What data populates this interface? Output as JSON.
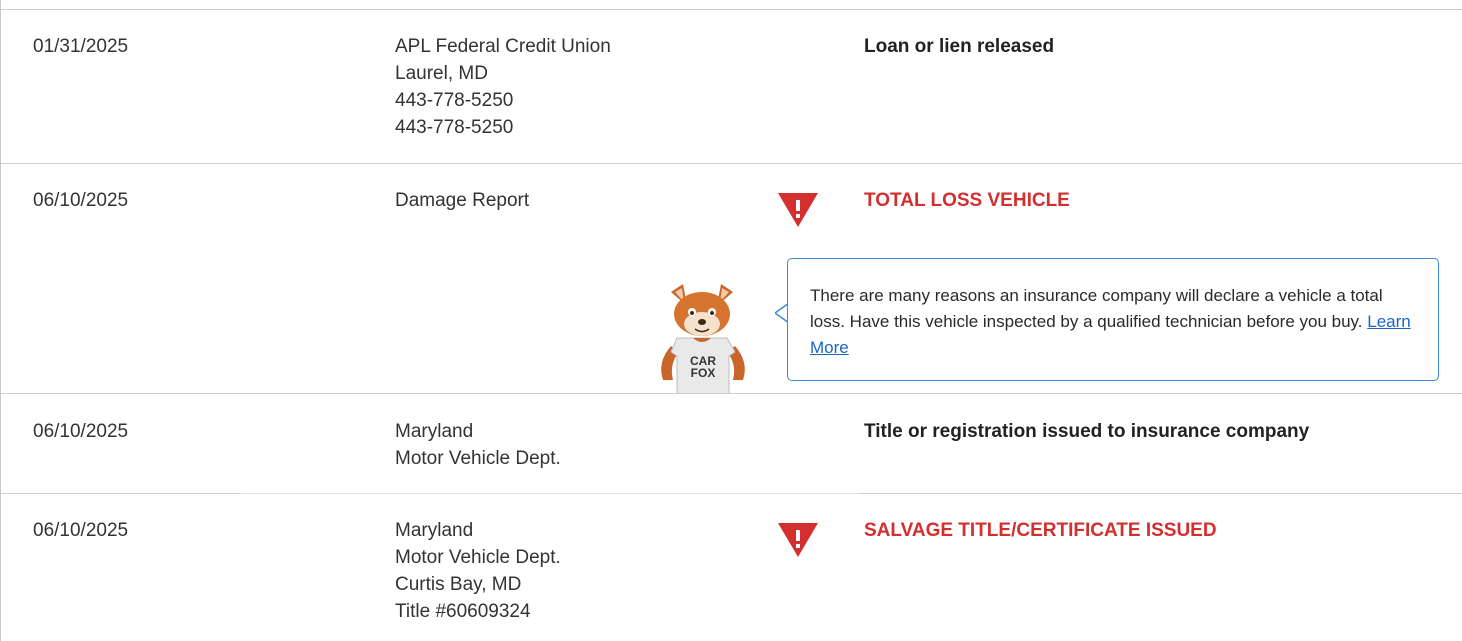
{
  "records": [
    {
      "date": "01/31/2025",
      "source_lines": [
        "APL Federal Credit Union",
        "Laurel, MD",
        "443-778-5250",
        "443-778-5250"
      ],
      "comment": "Loan or lien released",
      "alert": false
    },
    {
      "date": "06/10/2025",
      "source_lines": [
        "Damage Report"
      ],
      "comment": "TOTAL LOSS VEHICLE",
      "alert": true,
      "callout": {
        "text": "There are many reasons an insurance company will declare a vehicle a total loss. Have this vehicle inspected by a qualified technician before you buy.",
        "link_label": "Learn More"
      },
      "mascot_shirt": [
        "CAR",
        "FOX"
      ]
    },
    {
      "date": "06/10/2025",
      "source_lines": [
        "Maryland",
        "Motor Vehicle Dept."
      ],
      "comment": "Title or registration issued to insurance company",
      "alert": false
    },
    {
      "date": "06/10/2025",
      "source_lines": [
        "Maryland",
        "Motor Vehicle Dept.",
        "Curtis Bay, MD",
        "Title #60609324"
      ],
      "comment": "SALVAGE TITLE/CERTIFICATE ISSUED",
      "alert": true
    }
  ],
  "icons": {
    "alert": "warning-triangle-icon",
    "mascot": "carfox-mascot"
  },
  "colors": {
    "alert_red": "#d32f2f",
    "callout_border": "#3a8ad8",
    "link_blue": "#1a66c9",
    "divider": "#cfcfcf"
  }
}
